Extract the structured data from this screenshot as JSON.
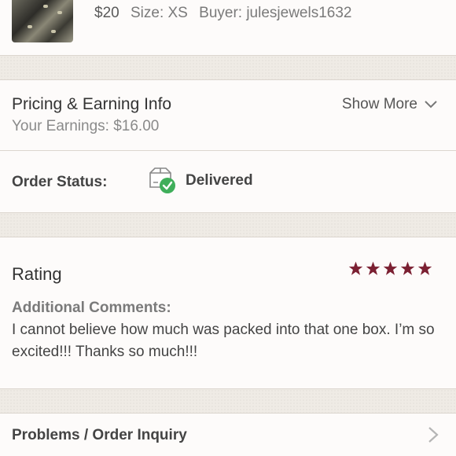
{
  "item": {
    "price": "$20",
    "size": "Size: XS",
    "buyer": "Buyer: julesjewels1632"
  },
  "pricing": {
    "title": "Pricing & Earning Info",
    "earnings": "Your Earnings: $16.00",
    "show_more_label": "Show More",
    "order_status_label": "Order Status:",
    "order_status_value": "Delivered",
    "icons": {
      "show_more": "chevron-down-icon",
      "status": "package-delivered-icon"
    }
  },
  "rating": {
    "title": "Rating",
    "stars": 5,
    "star_color": "#7b2032",
    "comments_label": "Additional Comments:",
    "comments_text": "I cannot believe how much was packed into that one box. I’m so excited!!! Thanks so much!!!"
  },
  "problems": {
    "label": "Problems / Order Inquiry",
    "icon": "chevron-right-icon"
  },
  "colors": {
    "background": "#efebe5",
    "card": "#fdfbfa",
    "success_green": "#3fae5a"
  }
}
